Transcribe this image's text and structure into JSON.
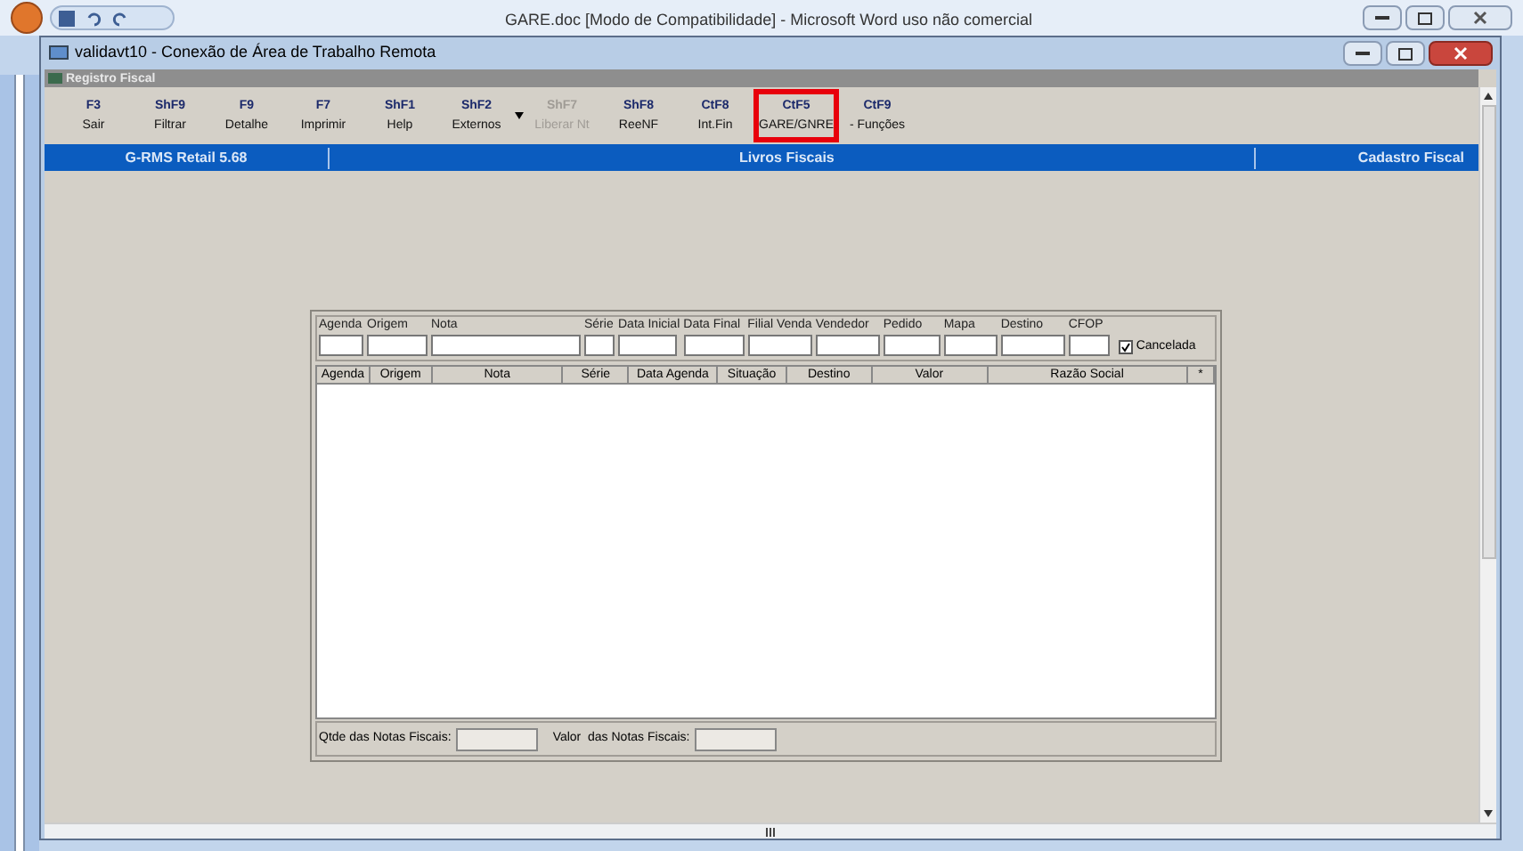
{
  "word_window": {
    "title": "GARE.doc [Modo de Compatibilidade] - Microsoft Word uso não comercial"
  },
  "remote_window": {
    "title": "validavt10 - Conexão de Área de Trabalho Remota"
  },
  "app_window": {
    "title": "Registro Fiscal"
  },
  "toolbar": [
    {
      "key": "F3",
      "label": "Sair",
      "disabled": false,
      "highlighted": false
    },
    {
      "key": "ShF9",
      "label": "Filtrar",
      "disabled": false,
      "highlighted": false
    },
    {
      "key": "F9",
      "label": "Detalhe",
      "disabled": false,
      "highlighted": false
    },
    {
      "key": "F7",
      "label": "Imprimir",
      "disabled": false,
      "highlighted": false
    },
    {
      "key": "ShF1",
      "label": "Help",
      "disabled": false,
      "highlighted": false
    },
    {
      "key": "ShF2",
      "label": "Externos",
      "disabled": false,
      "highlighted": false
    },
    {
      "key": "ShF7",
      "label": "Liberar Nt",
      "disabled": true,
      "highlighted": false
    },
    {
      "key": "ShF8",
      "label": "ReeNF",
      "disabled": false,
      "highlighted": false
    },
    {
      "key": "CtF8",
      "label": "Int.Fin",
      "disabled": false,
      "highlighted": false
    },
    {
      "key": "CtF5",
      "label": "GARE/GNRE",
      "disabled": false,
      "highlighted": true
    },
    {
      "key": "CtF9",
      "label": "- Funções",
      "disabled": false,
      "highlighted": false
    }
  ],
  "status_bar": [
    "G-RMS Retail 5.68",
    "Livros Fiscais",
    "Cadastro Fiscal"
  ],
  "filters": [
    "Agenda",
    "Origem",
    "Nota",
    "Série",
    "Data Inicial",
    "Data Final",
    "Filial Venda",
    "Vendedor",
    "Pedido",
    "Mapa",
    "Destino",
    "CFOP"
  ],
  "cancelada": {
    "label": "Cancelada",
    "checked": true
  },
  "table": {
    "columns": [
      "Agenda",
      "Origem",
      "Nota",
      "Série",
      "Data Agenda",
      "Situação",
      "Destino",
      "Valor",
      "Razão Social",
      "*"
    ]
  },
  "totals": [
    {
      "label": "Qtde das Notas Fiscais:"
    },
    {
      "label": "Valor  das Notas Fiscais:"
    }
  ]
}
